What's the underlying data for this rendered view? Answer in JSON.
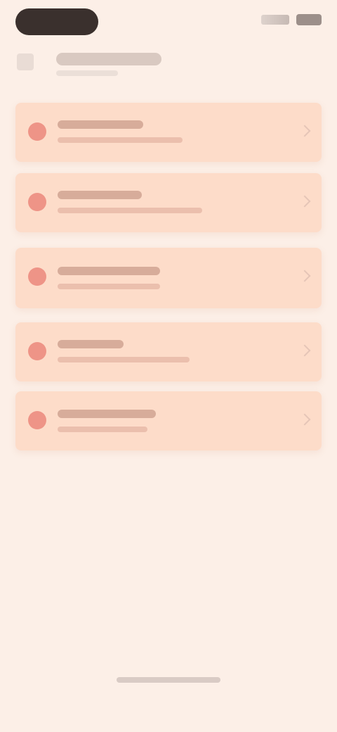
{
  "status_bar": {
    "left_icon": "camera-pill",
    "right_icons": [
      "signal-icon",
      "battery-icon"
    ]
  },
  "header": {
    "back_icon": "back-icon"
  },
  "cards": [
    {
      "icon": "info-icon",
      "title": "",
      "subtitle": ""
    },
    {
      "icon": "info-icon",
      "title": "",
      "subtitle": ""
    },
    {
      "icon": "info-icon",
      "title": "",
      "subtitle": ""
    },
    {
      "icon": "info-icon",
      "title": "",
      "subtitle": ""
    },
    {
      "icon": "info-icon",
      "title": "",
      "subtitle": ""
    }
  ],
  "colors": {
    "background": "#fcefe7",
    "card": "#fddcc9",
    "accent": "#e8786d"
  }
}
